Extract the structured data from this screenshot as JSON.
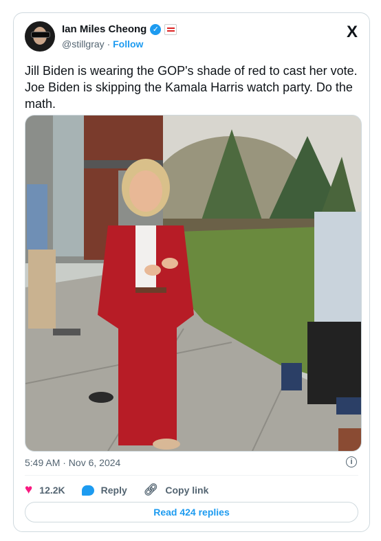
{
  "author": {
    "name": "Ian Miles Cheong",
    "handle": "@stillgray",
    "separator": "·",
    "follow_label": "Follow"
  },
  "brand": {
    "logo_text": "X",
    "logo_icon": "x-logo-icon"
  },
  "tweet": {
    "text": "Jill Biden is wearing the GOP's shade of red to cast her vote. Joe Biden is skipping the Kamala Harris watch party. Do the math.",
    "timestamp": "5:49 AM · Nov 6, 2024",
    "info_glyph": "i"
  },
  "photo": {
    "description_icon": "photo",
    "accent_color": "#b71c26"
  },
  "actions": {
    "likes": "12.2K",
    "reply_label": "Reply",
    "copy_link_label": "Copy link"
  },
  "read_replies_label": "Read 424 replies",
  "colors": {
    "accent": "#1d9bf0",
    "like": "#f91880",
    "muted": "#536471"
  }
}
